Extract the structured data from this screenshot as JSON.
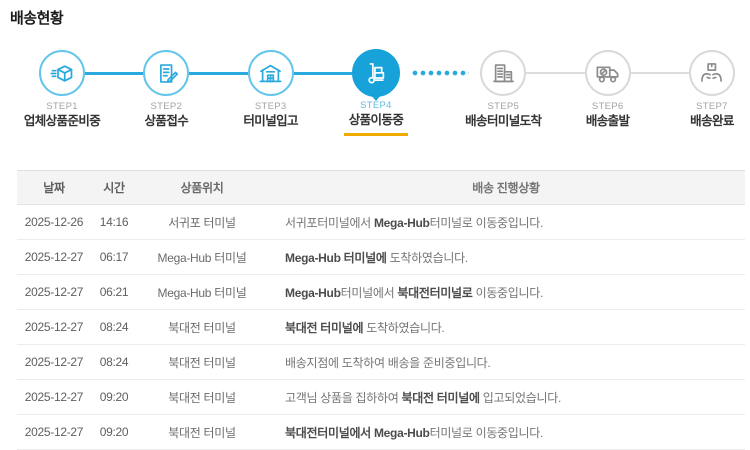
{
  "page": {
    "title": "배송현황"
  },
  "colors": {
    "accent_blue": "#17a2d9",
    "line_blue": "#2aa9de",
    "circle_blue_border": "#63c5ec",
    "inactive_gray": "#8c8c8c",
    "highlight_yellow": "#f0ab00",
    "header_bg": "#f4f4f4"
  },
  "steps": {
    "active_index": 3,
    "items": [
      {
        "step": "STEP1",
        "label": "업체상품준비중",
        "icon": "package-speed-icon",
        "state": "done"
      },
      {
        "step": "STEP2",
        "label": "상품접수",
        "icon": "document-pencil-icon",
        "state": "done"
      },
      {
        "step": "STEP3",
        "label": "터미널입고",
        "icon": "warehouse-icon",
        "state": "done"
      },
      {
        "step": "STEP4",
        "label": "상품이동중",
        "icon": "handtruck-icon",
        "state": "active"
      },
      {
        "step": "STEP5",
        "label": "배송터미널도착",
        "icon": "buildings-icon",
        "state": "pending"
      },
      {
        "step": "STEP6",
        "label": "배송출발",
        "icon": "delivery-truck-icon",
        "state": "pending"
      },
      {
        "step": "STEP7",
        "label": "배송완료",
        "icon": "hands-box-icon",
        "state": "pending"
      }
    ]
  },
  "table": {
    "headers": [
      "날짜",
      "시간",
      "상품위치",
      "배송 진행상황"
    ],
    "rows": [
      {
        "date": "2025-12-26",
        "time": "14:16",
        "location": "서귀포 터미널",
        "progress": [
          {
            "text": "서귀포터미널에서 ",
            "bold": false
          },
          {
            "text": "Mega-Hub",
            "bold": true
          },
          {
            "text": "터미널로 이동중입니다.",
            "bold": false
          }
        ]
      },
      {
        "date": "2025-12-27",
        "time": "06:17",
        "location": "Mega-Hub 터미널",
        "progress": [
          {
            "text": "Mega-Hub 터미널에",
            "bold": true
          },
          {
            "text": " 도착하였습니다.",
            "bold": false
          }
        ]
      },
      {
        "date": "2025-12-27",
        "time": "06:21",
        "location": "Mega-Hub 터미널",
        "progress": [
          {
            "text": "Mega-Hub",
            "bold": true
          },
          {
            "text": "터미널에서 ",
            "bold": false
          },
          {
            "text": "북대전터미널로",
            "bold": true
          },
          {
            "text": " 이동중입니다.",
            "bold": false
          }
        ]
      },
      {
        "date": "2025-12-27",
        "time": "08:24",
        "location": "북대전 터미널",
        "progress": [
          {
            "text": "북대전 터미널에",
            "bold": true
          },
          {
            "text": " 도착하였습니다.",
            "bold": false
          }
        ]
      },
      {
        "date": "2025-12-27",
        "time": "08:24",
        "location": "북대전 터미널",
        "progress": [
          {
            "text": "배송지점에 도착하여 배송을 준비중입니다.",
            "bold": false
          }
        ]
      },
      {
        "date": "2025-12-27",
        "time": "09:20",
        "location": "북대전 터미널",
        "progress": [
          {
            "text": "고객님 상품을 집하하여 ",
            "bold": false
          },
          {
            "text": "북대전 터미널에",
            "bold": true
          },
          {
            "text": " 입고되었습니다.",
            "bold": false
          }
        ]
      },
      {
        "date": "2025-12-27",
        "time": "09:20",
        "location": "북대전 터미널",
        "progress": [
          {
            "text": "북대전터미널에서 ",
            "bold": true
          },
          {
            "text": "Mega-Hub",
            "bold": true
          },
          {
            "text": "터미널로 이동중입니다.",
            "bold": false
          }
        ]
      }
    ]
  }
}
